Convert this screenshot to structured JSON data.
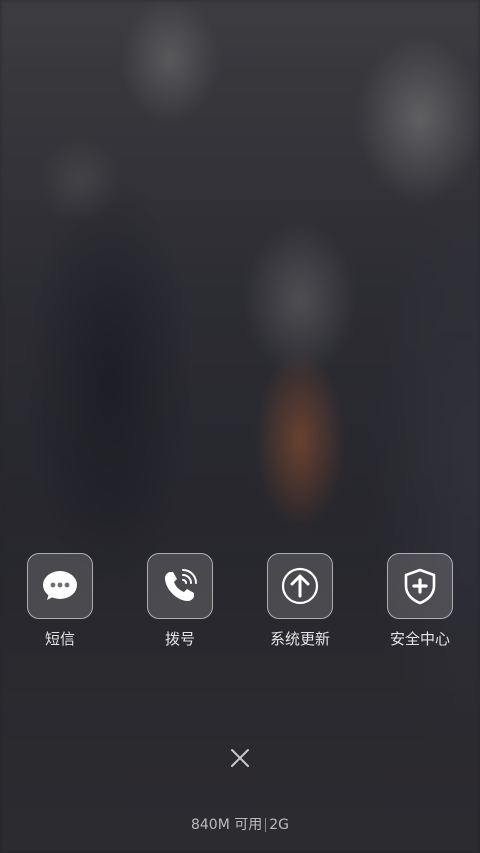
{
  "apps": [
    {
      "label": "短信",
      "icon": "message-icon"
    },
    {
      "label": "拨号",
      "icon": "phone-icon"
    },
    {
      "label": "系统更新",
      "icon": "system-update-icon"
    },
    {
      "label": "安全中心",
      "icon": "shield-icon"
    }
  ],
  "close": {
    "icon": "close-icon"
  },
  "status": {
    "memory": "840M 可用",
    "network": "2G"
  },
  "colors": {
    "text": "#ffffff",
    "icon_border": "#ffffff"
  }
}
